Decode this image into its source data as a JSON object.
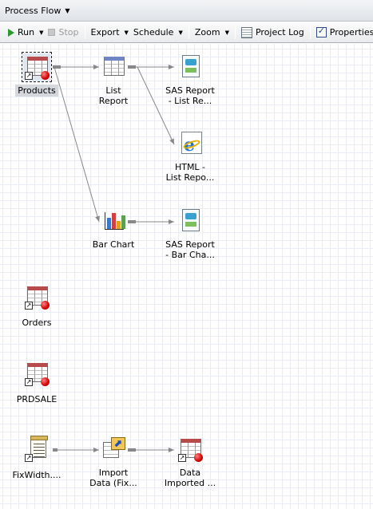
{
  "window": {
    "title": "Process Flow"
  },
  "toolbar": {
    "run": "Run",
    "stop": "Stop",
    "export": "Export",
    "schedule": "Schedule",
    "zoom": "Zoom",
    "project_log": "Project Log",
    "properties": "Properties"
  },
  "nodes": {
    "products": "Products",
    "list_report": [
      "List",
      "Report"
    ],
    "sas_report_list": [
      "SAS Report",
      "- List Re..."
    ],
    "html_list": [
      "HTML -",
      "List Repo..."
    ],
    "bar_chart": "Bar Chart",
    "sas_report_bar": [
      "SAS Report",
      "- Bar Cha..."
    ],
    "orders": "Orders",
    "prdsale": "PRDSALE",
    "fixwidth": "FixWidth....",
    "import_data": [
      "Import",
      "Data (Fix..."
    ],
    "data_imported": [
      "Data",
      "Imported ..."
    ]
  },
  "colors": {
    "run_green": "#2e9a2e",
    "link_gray": "#888888",
    "selection_gray": "#d4d7db"
  }
}
